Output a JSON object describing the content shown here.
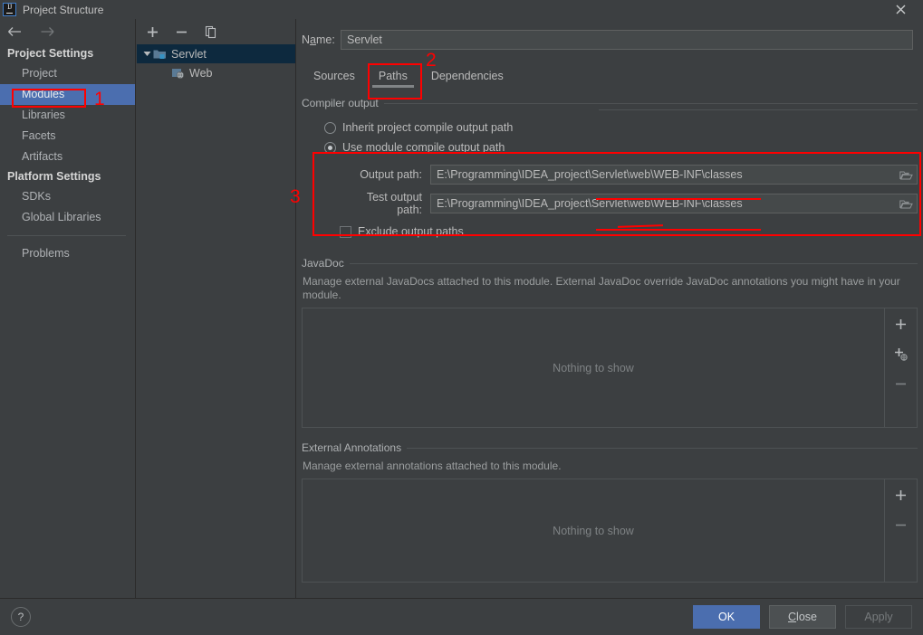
{
  "window": {
    "title": "Project Structure",
    "app_icon": "intellij-idea-logo",
    "close_icon": "close-icon"
  },
  "sidebar": {
    "back_icon": "arrow-left-icon",
    "forward_icon": "arrow-right-icon",
    "groups": [
      {
        "title": "Project Settings",
        "items": [
          {
            "label": "Project",
            "selected": false
          },
          {
            "label": "Modules",
            "selected": true
          },
          {
            "label": "Libraries",
            "selected": false
          },
          {
            "label": "Facets",
            "selected": false
          },
          {
            "label": "Artifacts",
            "selected": false
          }
        ]
      },
      {
        "title": "Platform Settings",
        "items": [
          {
            "label": "SDKs",
            "selected": false
          },
          {
            "label": "Global Libraries",
            "selected": false
          }
        ]
      }
    ],
    "problems_label": "Problems"
  },
  "module_panel": {
    "toolbar": {
      "add_icon": "plus-icon",
      "remove_icon": "minus-icon",
      "copy_icon": "copy-icon"
    },
    "tree": [
      {
        "label": "Servlet",
        "icon": "module-folder-icon",
        "selected": true,
        "expanded": true,
        "depth": 0
      },
      {
        "label": "Web",
        "icon": "web-facet-icon",
        "selected": false,
        "depth": 1
      }
    ]
  },
  "main": {
    "name_label": "Name:",
    "name_value": "Servlet",
    "tabs": [
      {
        "label": "Sources",
        "active": false
      },
      {
        "label": "Paths",
        "active": true
      },
      {
        "label": "Dependencies",
        "active": false
      }
    ],
    "compiler_output": {
      "title": "Compiler output",
      "inherit_label": "Inherit project compile output path",
      "inherit_selected": false,
      "module_label": "Use module compile output path",
      "module_selected": true,
      "output_path_label": "Output path:",
      "output_path_value": "E:\\Programming\\IDEA_project\\Servlet\\web\\WEB-INF\\classes",
      "test_output_path_label": "Test output path:",
      "test_output_path_value": "E:\\Programming\\IDEA_project\\Servlet\\web\\WEB-INF\\classes",
      "browse_icon": "folder-browse-icon",
      "exclude_label": "Exclude output paths",
      "exclude_checked": false
    },
    "javadoc": {
      "title": "JavaDoc",
      "description": "Manage external JavaDocs attached to this module. External JavaDoc override JavaDoc annotations you might have in your module.",
      "empty_text": "Nothing to show",
      "buttons": [
        {
          "icon": "plus-icon",
          "name": "add-javadoc-path-button"
        },
        {
          "icon": "plus-globe-icon",
          "name": "add-javadoc-url-button"
        },
        {
          "icon": "minus-icon",
          "name": "remove-javadoc-button"
        }
      ]
    },
    "external_annotations": {
      "title": "External Annotations",
      "description": "Manage external annotations attached to this module.",
      "empty_text": "Nothing to show",
      "buttons": [
        {
          "icon": "plus-icon",
          "name": "add-annotation-button"
        },
        {
          "icon": "minus-icon",
          "name": "remove-annotation-button"
        }
      ]
    }
  },
  "footer": {
    "help_icon": "question-mark-icon",
    "ok_label": "OK",
    "close_label": "Close",
    "apply_label": "Apply",
    "apply_disabled": true
  },
  "annotations": {
    "marker_1": "1",
    "marker_2": "2",
    "marker_3": "3",
    "color": "#ff0000"
  },
  "colors": {
    "background": "#3c3f41",
    "selection_blue": "#4b6eaf",
    "tree_selection": "#0d293e",
    "field_background": "#45494a",
    "text": "#bbbbbb",
    "annotation_red": "#ff0000"
  }
}
